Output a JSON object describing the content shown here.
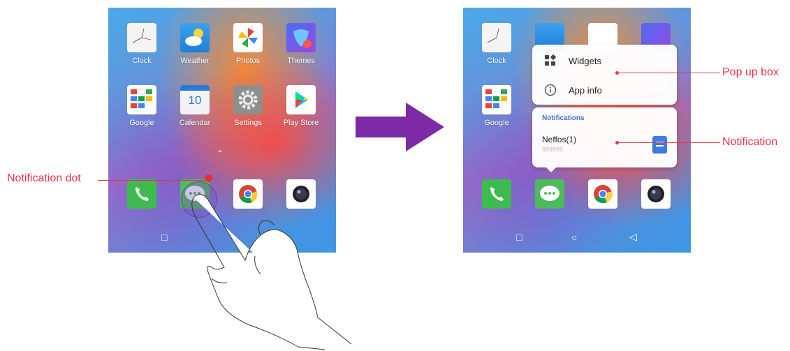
{
  "apps": {
    "clock": "Clock",
    "weather": "Weather",
    "photos": "Photos",
    "themes": "Themes",
    "google": "Google",
    "calendar": "Calendar",
    "calendar_date": "10",
    "settings": "Settings",
    "play_store": "Play Store"
  },
  "popup": {
    "widgets": "Widgets",
    "app_info": "App info",
    "notifications_header": "Notifications",
    "notification_title": "Neffos(1)",
    "notification_body": "999999"
  },
  "callouts": {
    "notification_dot": "Notification dot",
    "pop_up_box": "Pop up box",
    "notification": "Notification"
  },
  "colors": {
    "callout": "#e8334b",
    "arrow": "#7c2aa6",
    "notif_dot": "#e83030",
    "notif_header": "#3f6fd0"
  }
}
